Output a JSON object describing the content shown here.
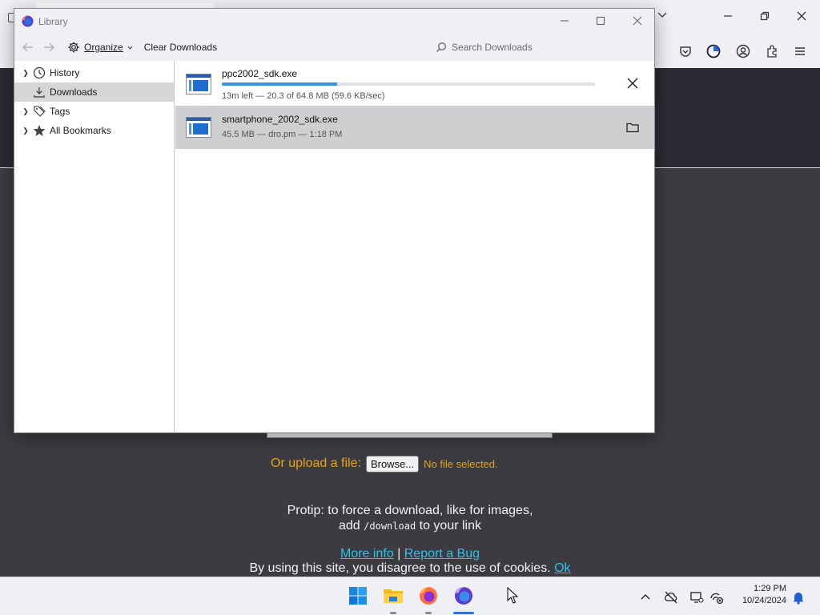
{
  "library": {
    "title": "Library",
    "toolbar": {
      "organize_label": "Organize",
      "clear_label": "Clear Downloads",
      "search_placeholder": "Search Downloads"
    },
    "sidebar": {
      "items": [
        {
          "label": "History",
          "icon": "clock-icon",
          "expandable": true
        },
        {
          "label": "Downloads",
          "icon": "download-icon",
          "expandable": false,
          "selected": true
        },
        {
          "label": "Tags",
          "icon": "tags-icon",
          "expandable": true
        },
        {
          "label": "All Bookmarks",
          "icon": "star-icon",
          "expandable": true
        }
      ]
    },
    "downloads": [
      {
        "name": "ppc2002_sdk.exe",
        "status": "13m left — 20.3 of 64.8 MB (59.6 KB/sec)",
        "progress": 0.31,
        "action": "cancel-icon"
      },
      {
        "name": "smartphone_2002_sdk.exe",
        "status": "45.5 MB — dro.pm — 1:18 PM",
        "action": "folder-icon",
        "selected": true
      }
    ]
  },
  "page": {
    "upload_label": "Or upload a file:",
    "browse_label": "Browse...",
    "no_file": "No file selected.",
    "protip_line1": "Protip: to force a download, like for images,",
    "protip_add": "add",
    "protip_code": "/download",
    "protip_tail": "to your link",
    "more_info": "More info",
    "separator": "|",
    "report_bug": "Report a Bug",
    "cookie_text": "By using this site, you disagree to the use of cookies.",
    "cookie_ok": "Ok"
  },
  "taskbar": {
    "time": "1:29 PM",
    "date": "10/24/2024"
  },
  "colors": {
    "accent_orange": "#e8a317",
    "link_cyan": "#2bc4e8",
    "progress_blue": "#3a91e0"
  }
}
